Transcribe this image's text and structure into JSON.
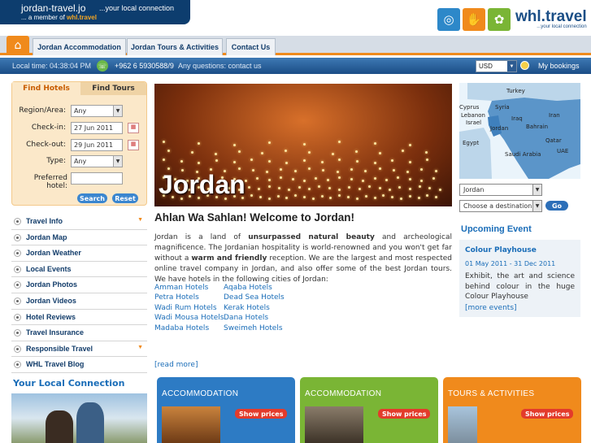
{
  "header": {
    "site_name": "jordan-travel.jo",
    "tagline": "...your local connection",
    "member_text": "... a member of",
    "member_brand": "whl.travel",
    "logo_name": "whl.travel",
    "logo_sub": "...your local connection"
  },
  "nav": {
    "home_icon": "home-icon",
    "tabs": [
      "Jordan Accommodation",
      "Jordan Tours & Activities",
      "Contact Us"
    ]
  },
  "infobar": {
    "local_time": "Local time: 04:38:04 PM",
    "phone": "+962 6 5930588/9",
    "contact": "Any questions: contact us",
    "currency": "USD",
    "bookings": "My bookings"
  },
  "search": {
    "tab_hotels": "Find Hotels",
    "tab_tours": "Find Tours",
    "region_label": "Region/Area:",
    "region_value": "Any",
    "checkin_label": "Check-in:",
    "checkin_value": "27 Jun 2011",
    "checkout_label": "Check-out:",
    "checkout_value": "29 Jun 2011",
    "type_label": "Type:",
    "type_value": "Any",
    "preferred_label": "Preferred hotel:",
    "preferred_value": "",
    "search_btn": "Search",
    "reset_btn": "Reset"
  },
  "menu": [
    {
      "label": "Travel Info",
      "arrow": true
    },
    {
      "label": "Jordan Map",
      "arrow": false
    },
    {
      "label": "Jordan Weather",
      "arrow": false
    },
    {
      "label": "Local Events",
      "arrow": false
    },
    {
      "label": "Jordan Photos",
      "arrow": false
    },
    {
      "label": "Jordan Videos",
      "arrow": false
    },
    {
      "label": "Hotel Reviews",
      "arrow": false
    },
    {
      "label": "Travel Insurance",
      "arrow": false
    },
    {
      "label": "Responsible Travel",
      "arrow": true
    },
    {
      "label": "WHL Travel Blog",
      "arrow": false
    }
  ],
  "your_local": "Your Local Connection",
  "hero": {
    "title": "Jordan"
  },
  "main": {
    "welcome": "Ahlan Wa Sahlan! Welcome to Jordan!",
    "intro_1": "Jordan is a land of ",
    "intro_b1": "unsurpassed natural beauty",
    "intro_2": " and archeological magnificence. The Jordanian hospitality is world-renowned and you won't get far without a ",
    "intro_b2": "warm and friendly",
    "intro_3": " reception. We are the largest and most respected online travel company in Jordan, and also offer some of the best Jordan tours. We have hotels in the following cities of Jordan:",
    "cities_col1": [
      "Amman Hotels",
      "Petra Hotels",
      "Wadi Rum Hotels",
      "Wadi Mousa Hotels",
      "Madaba Hotels"
    ],
    "cities_col2": [
      "Aqaba Hotels",
      "Dead Sea Hotels",
      "Kerak Hotels",
      "Dana Hotels",
      "Sweimeh Hotels"
    ],
    "read_more": "[read more]"
  },
  "cards": [
    {
      "title": "ACCOMMODATION",
      "button": "Show prices",
      "color": "#2d7bc4"
    },
    {
      "title": "ACCOMMODATION",
      "button": "Show prices",
      "color": "#7ab535"
    },
    {
      "title": "TOURS & ACTIVITIES",
      "button": "Show prices",
      "color": "#f08a1c"
    }
  ],
  "map": {
    "labels": [
      "Turkey",
      "Cyprus",
      "Syria",
      "Lebanon",
      "Israel",
      "Iraq",
      "Iran",
      "Jordan",
      "Bahrain",
      "Egypt",
      "Qatar",
      "UAE",
      "Saudi Arabia"
    ]
  },
  "destination": {
    "country": "Jordan",
    "placeholder": "Choose a destination",
    "go": "Go"
  },
  "event": {
    "section_title": "Upcoming Event",
    "name": "Colour Playhouse",
    "dates": "01 May 2011 - 31 Dec 2011",
    "description": "Exhibit, the art and science behind colour in the huge Colour Playhouse",
    "more": "[more events]"
  },
  "colors": {
    "brand_blue": "#0d3d6e",
    "accent_orange": "#f08a1c",
    "link_blue": "#1a6db8"
  }
}
